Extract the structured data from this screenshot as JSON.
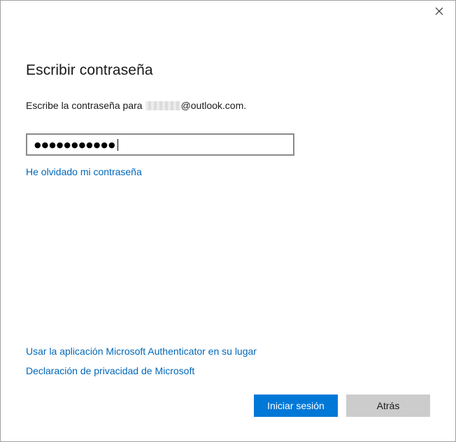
{
  "dialog": {
    "close_icon": "close-icon",
    "title": "Escribir contraseña",
    "prompt_prefix": "Escribe la contraseña para",
    "prompt_suffix": "@outlook.com.",
    "password_field": {
      "masked_value": "●●●●●●●●●●●"
    },
    "forgot_link": "He olvidado mi contraseña",
    "authenticator_link": "Usar la aplicación Microsoft Authenticator en su lugar",
    "privacy_link": "Declaración de privacidad de Microsoft",
    "sign_in_button": "Iniciar sesión",
    "back_button": "Atrás"
  },
  "colors": {
    "accent": "#0078d7",
    "link": "#0067b8",
    "secondary_button": "#cccccc"
  }
}
